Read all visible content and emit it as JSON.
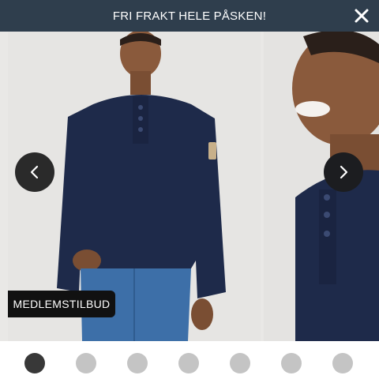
{
  "banner": {
    "text": "FRI FRAKT HELE PÅSKEN!",
    "close_icon": "close-icon"
  },
  "gallery": {
    "badge": "MEDLEMSTILBUD",
    "prev_icon": "chevron-left-icon",
    "next_icon": "chevron-right-icon",
    "slide_count": 7,
    "active_index": 0
  },
  "colors": {
    "banner_bg": "#2f3e4d",
    "shirt": "#1e2a4a",
    "jeans": "#3d6fa8",
    "active_dot": "#383838",
    "inactive_dot": "#c4c4c4"
  }
}
